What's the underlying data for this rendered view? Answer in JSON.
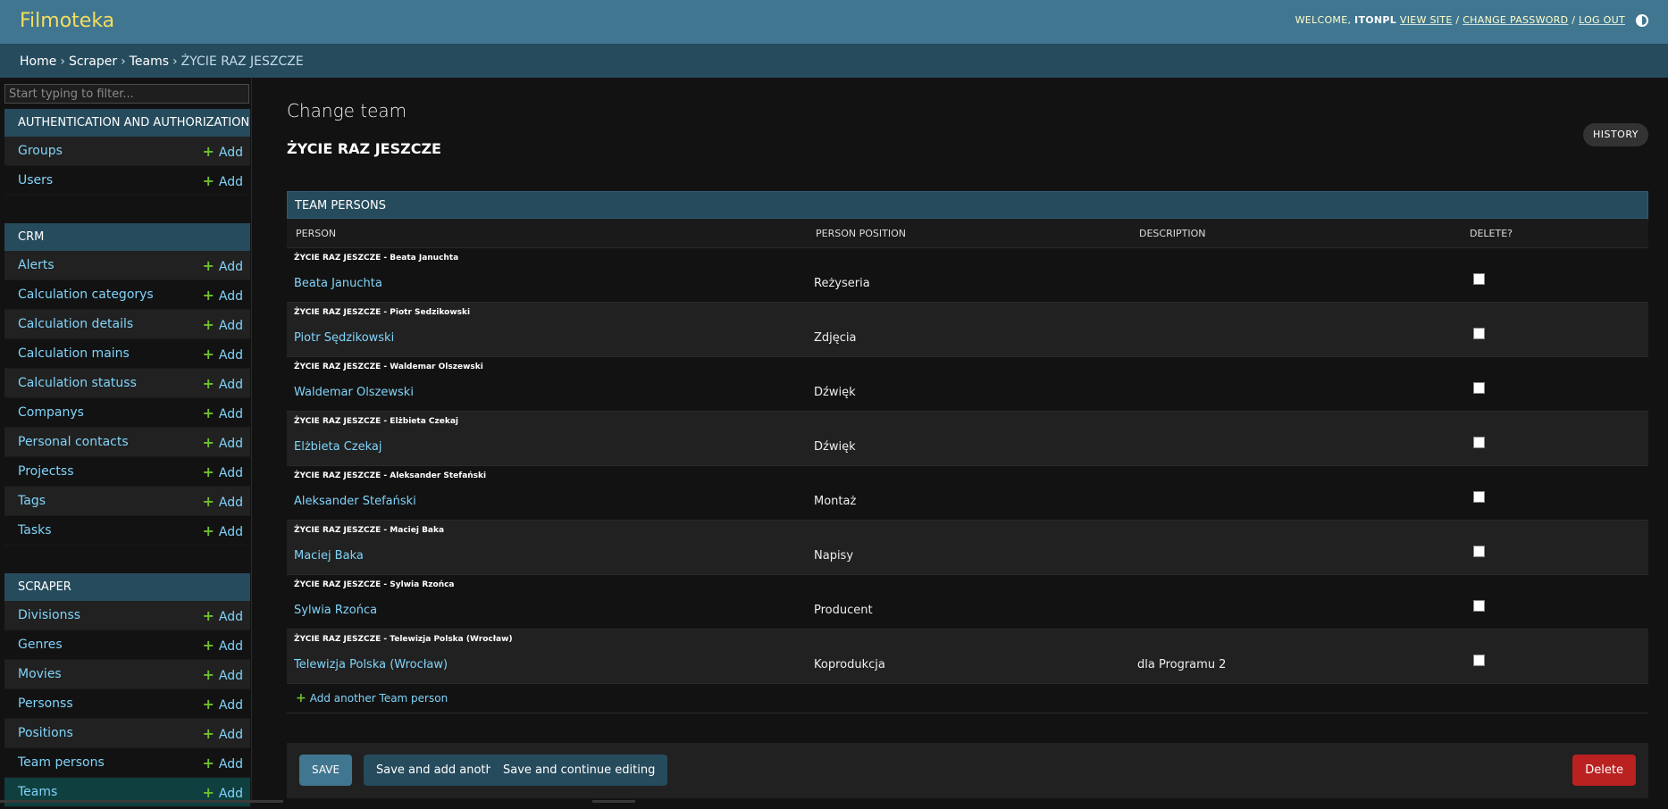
{
  "header": {
    "brand": "Filmoteka",
    "welcome": "WELCOME,",
    "username": "ITONPL",
    "view_site": "VIEW SITE",
    "sep1": "/",
    "change_password": "CHANGE PASSWORD",
    "sep2": "/",
    "log_out": "LOG OUT"
  },
  "breadcrumbs": {
    "home": "Home",
    "app": "Scraper",
    "model": "Teams",
    "current": "ŻYCIE RAZ JESZCZE",
    "sep": "›"
  },
  "sidebar": {
    "filter_placeholder": "Start typing to filter...",
    "add_label": "Add",
    "apps": [
      {
        "name": "AUTHENTICATION AND AUTHORIZATION",
        "models": [
          "Groups",
          "Users"
        ]
      },
      {
        "name": "CRM",
        "models": [
          "Alerts",
          "Calculation categorys",
          "Calculation details",
          "Calculation mains",
          "Calculation statuss",
          "Companys",
          "Personal contacts",
          "Projectss",
          "Tags",
          "Tasks"
        ]
      },
      {
        "name": "SCRAPER",
        "models": [
          "Divisionss",
          "Genres",
          "Movies",
          "Personss",
          "Positions",
          "Team persons",
          "Teams"
        ]
      }
    ]
  },
  "main": {
    "page_title": "Change team",
    "object_title": "ŻYCIE RAZ JESZCZE",
    "history": "HISTORY"
  },
  "inline": {
    "caption": "TEAM PERSONS",
    "columns": [
      "PERSON",
      "PERSON POSITION",
      "DESCRIPTION",
      "DELETE?"
    ],
    "rows": [
      {
        "original": "ŻYCIE RAZ JESZCZE - Beata Januchta",
        "person": "Beata Januchta",
        "position": "Reżyseria",
        "description": ""
      },
      {
        "original": "ŻYCIE RAZ JESZCZE - Piotr Sedzikowski",
        "person": "Piotr Sędzikowski",
        "position": "Zdjęcia",
        "description": ""
      },
      {
        "original": "ŻYCIE RAZ JESZCZE - Waldemar Olszewski",
        "person": "Waldemar Olszewski",
        "position": "Dźwięk",
        "description": ""
      },
      {
        "original": "ŻYCIE RAZ JESZCZE - Elżbieta Czekaj",
        "person": "Elżbieta Czekaj",
        "position": "Dźwięk",
        "description": ""
      },
      {
        "original": "ŻYCIE RAZ JESZCZE - Aleksander Stefański",
        "person": "Aleksander Stefański",
        "position": "Montaż",
        "description": ""
      },
      {
        "original": "ŻYCIE RAZ JESZCZE - Maciej Baka",
        "person": "Maciej Baka",
        "position": "Napisy",
        "description": ""
      },
      {
        "original": "ŻYCIE RAZ JESZCZE - Sylwia Rzońca",
        "person": "Sylwia Rzońca",
        "position": "Producent",
        "description": ""
      },
      {
        "original": "ŻYCIE RAZ JESZCZE - Telewizja Polska (Wrocław)",
        "person": "Telewizja Polska (Wrocław)",
        "position": "Koprodukcja",
        "description": "dla Programu 2"
      }
    ],
    "add_another": "Add another Team person"
  },
  "submit": {
    "save": "SAVE",
    "save_add": "Save and add another",
    "save_continue": "Save and continue editing",
    "delete": "Delete"
  },
  "colors": {
    "header_bg": "#417690",
    "breadcrumb_bg": "#264b5d",
    "brand": "#f5dd5d",
    "link": "#81d4fa",
    "add_plus": "#70bf2b",
    "delete_button": "#ba2121"
  }
}
